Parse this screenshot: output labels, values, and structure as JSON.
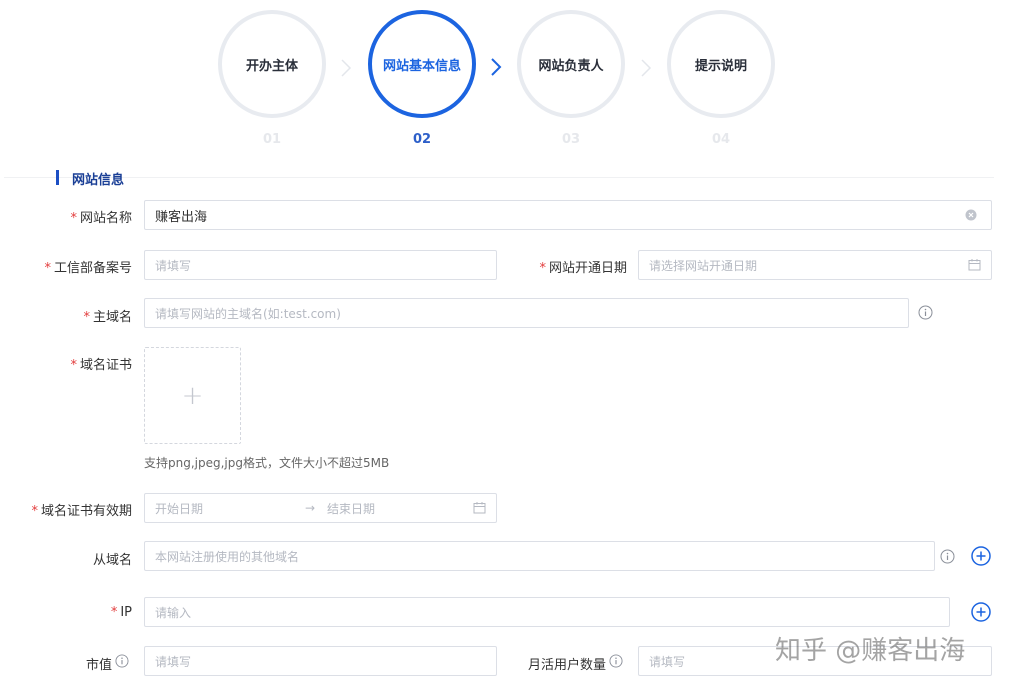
{
  "steps": [
    {
      "label": "开办主体",
      "number": "01",
      "active": false
    },
    {
      "label": "网站基本信息",
      "number": "02",
      "active": true
    },
    {
      "label": "网站负责人",
      "number": "03",
      "active": false
    },
    {
      "label": "提示说明",
      "number": "04",
      "active": false
    }
  ],
  "section": {
    "title": "网站信息"
  },
  "form": {
    "site_name": {
      "label": "网站名称",
      "value": "赚客出海"
    },
    "icp": {
      "label": "工信部备案号",
      "placeholder": "请填写"
    },
    "open_date": {
      "label": "网站开通日期",
      "placeholder": "请选择网站开通日期"
    },
    "main_domain": {
      "label": "主域名",
      "placeholder": "请填写网站的主域名(如:test.com)"
    },
    "cert": {
      "label": "域名证书",
      "upload_plus": "+",
      "hint": "支持png,jpeg,jpg格式，文件大小不超过5MB"
    },
    "cert_validity": {
      "label": "域名证书有效期",
      "start_placeholder": "开始日期",
      "separator": "→",
      "end_placeholder": "结束日期"
    },
    "sub_domain": {
      "label": "从域名",
      "placeholder": "本网站注册使用的其他域名"
    },
    "ip": {
      "label": "IP",
      "placeholder": "请输入"
    },
    "market_value": {
      "label": "市值",
      "placeholder": "请填写"
    },
    "mau": {
      "label": "月活用户数量",
      "placeholder": "请填写"
    }
  },
  "required_mark": "*",
  "watermark": "知乎 @赚客出海",
  "colors": {
    "accent": "#1c64e0",
    "required": "#e23b3b",
    "border": "#dcdfe6"
  }
}
